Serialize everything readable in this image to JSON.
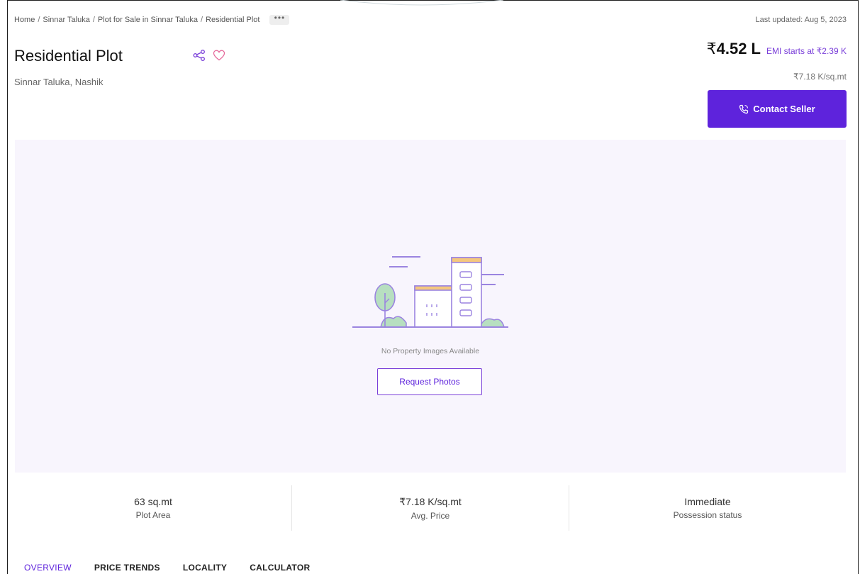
{
  "breadcrumb": {
    "items": [
      "Home",
      "Sinnar Taluka",
      "Plot for Sale in Sinnar Taluka",
      "Residential Plot"
    ],
    "separator": "/",
    "more": "•••"
  },
  "last_updated": "Last updated: Aug 5, 2023",
  "property": {
    "title": "Residential Plot",
    "location": "Sinnar Taluka, Nashik"
  },
  "pricing": {
    "price": "4.52 L",
    "currency_symbol": "₹",
    "emi": "EMI starts at ₹2.39 K",
    "per_unit": "₹7.18 K/sq.mt"
  },
  "contact": {
    "label": "Contact Seller"
  },
  "media": {
    "empty_text": "No Property Images Available",
    "request_label": "Request Photos"
  },
  "stats": [
    {
      "value": "63 sq.mt",
      "label": "Plot Area"
    },
    {
      "value": "₹7.18 K/sq.mt",
      "label": "Avg. Price"
    },
    {
      "value": "Immediate",
      "label": "Possession status"
    }
  ],
  "tabs": [
    {
      "label": "OVERVIEW",
      "active": true
    },
    {
      "label": "PRICE TRENDS",
      "active": false
    },
    {
      "label": "LOCALITY",
      "active": false
    },
    {
      "label": "CALCULATOR",
      "active": false
    }
  ],
  "colors": {
    "accent": "#5e23dc",
    "accent_light": "#7a3fd9",
    "media_bg": "#f8f5fd"
  },
  "icons": [
    "share-icon",
    "heart-icon",
    "phone-icon",
    "building-illustration"
  ]
}
